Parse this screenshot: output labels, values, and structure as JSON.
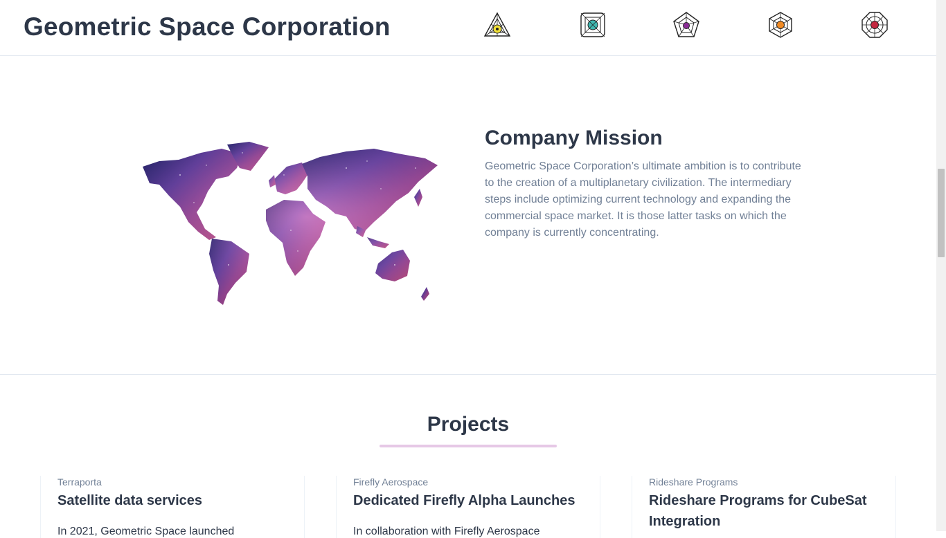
{
  "header": {
    "brand": "Geometric Space Corporation",
    "nav_icons": [
      {
        "name": "triangle-emblem-icon",
        "accent": "#f2e23a"
      },
      {
        "name": "square-emblem-icon",
        "accent": "#3fb7b0"
      },
      {
        "name": "pentagon-emblem-icon",
        "accent": "#8a2d96"
      },
      {
        "name": "hexagon-emblem-icon",
        "accent": "#f08a24"
      },
      {
        "name": "octagon-emblem-icon",
        "accent": "#c3263f"
      }
    ]
  },
  "mission": {
    "title": "Company Mission",
    "text": "Geometric Space Corporation’s ultimate ambition is to contribute to the creation of a multiplanetary civilization. The intermediary steps include optimizing current technology and expanding the commercial space market. It is those latter tasks on which the company is currently concentrating.",
    "image": "world-map-galaxy"
  },
  "projects": {
    "title": "Projects",
    "underline_color": "#e6c8e6",
    "cards": [
      {
        "company": "Terraporta",
        "title": "Satellite data services",
        "text": "In 2021, Geometric Space launched"
      },
      {
        "company": "Firefly Aerospace",
        "title": "Dedicated Firefly Alpha Launches",
        "text": "In collaboration with Firefly Aerospace"
      },
      {
        "company": "Rideshare Programs",
        "title": "Rideshare Programs for CubeSat Integration",
        "text": ""
      }
    ]
  },
  "colors": {
    "heading": "#2d3748",
    "muted": "#718096",
    "border": "#e2e8f0"
  }
}
